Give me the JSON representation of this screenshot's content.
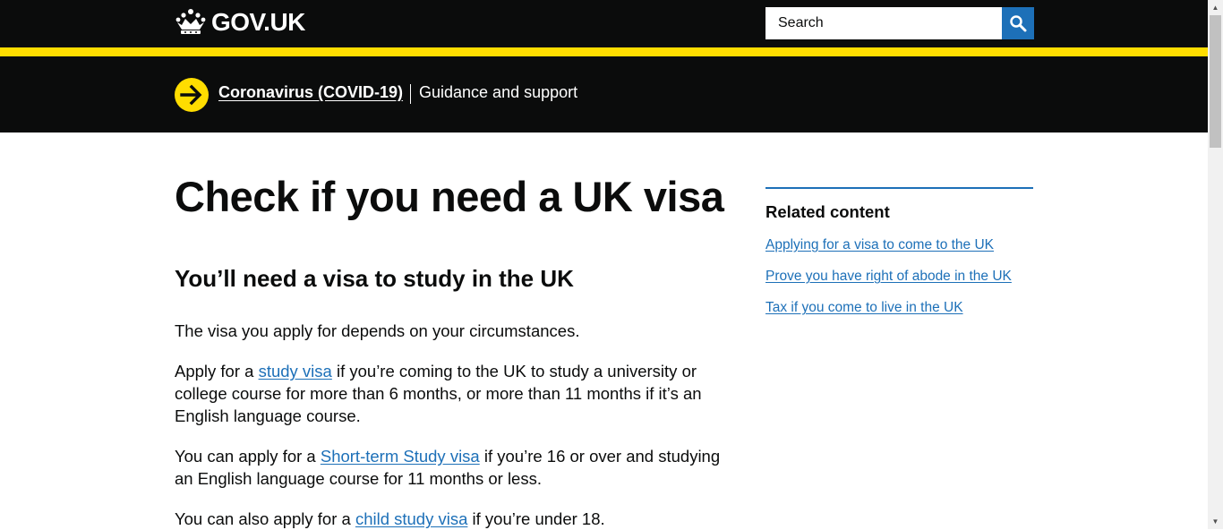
{
  "header": {
    "logo_text": "GOV.UK",
    "search_placeholder": "Search",
    "brand_colors": {
      "black": "#0b0c0c",
      "yellow": "#ffdd00",
      "link_blue": "#1d70b8"
    },
    "icons": {
      "logo": "crown-icon",
      "search": "search-icon"
    }
  },
  "covid_banner": {
    "link": "Coronavirus (COVID-19)",
    "text": "Guidance and support",
    "icon": "arrow-right-circle-icon"
  },
  "main": {
    "title": "Check if you need a UK visa",
    "subtitle": "You’ll need a visa to study in the UK",
    "paragraphs": [
      {
        "text": "The visa you apply for depends on your circumstances."
      },
      {
        "before": "Apply for a ",
        "link": "study visa",
        "after": " if you’re coming to the UK to study a university or college course for more than 6 months, or more than 11 months if it’s an English language course."
      },
      {
        "before": "You can apply for a ",
        "link": "Short-term Study visa",
        "after": " if you’re 16 or over and studying an English language course for 11 months or less."
      },
      {
        "before": "You can also apply for a ",
        "link": "child study visa",
        "after": " if you’re under 18."
      }
    ]
  },
  "related": {
    "title": "Related content",
    "links": [
      "Applying for a visa to come to the UK",
      "Prove you have right of abode in the UK",
      "Tax if you come to live in the UK"
    ]
  }
}
